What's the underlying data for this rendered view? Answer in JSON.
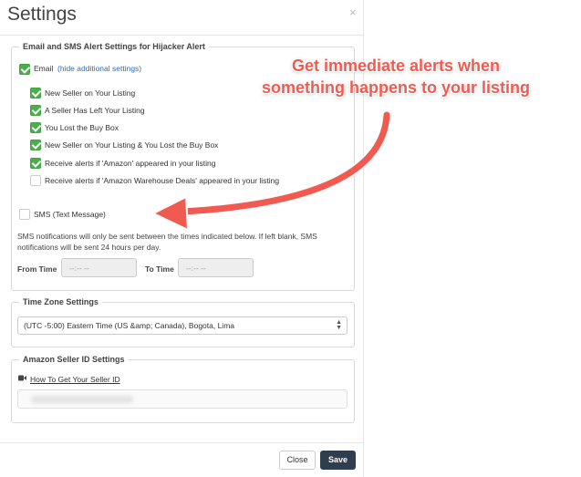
{
  "modal": {
    "title": "Settings",
    "close_symbol": "×"
  },
  "email_section": {
    "legend": "Email and SMS Alert Settings for Hijacker Alert",
    "email": {
      "label": "Email",
      "checked": true,
      "link": "(hide additional settings)"
    },
    "options": [
      {
        "label": "New Seller on Your Listing",
        "checked": true
      },
      {
        "label": "A Seller Has Left Your Listing",
        "checked": true
      },
      {
        "label": "You Lost the Buy Box",
        "checked": true
      },
      {
        "label": "New Seller on Your Listing & You Lost the Buy Box",
        "checked": true
      },
      {
        "label": "Receive alerts if 'Amazon' appeared in your listing",
        "checked": true
      },
      {
        "label": "Receive alerts if 'Amazon Warehouse Deals' appeared in your listing",
        "checked": false
      }
    ],
    "sms": {
      "label": "SMS (Text Message)",
      "checked": false
    },
    "sms_note": "SMS notifications will only be sent between the times indicated below. If left blank, SMS notifications will be sent 24 hours per day.",
    "from_time": {
      "label": "From Time",
      "placeholder": "--:-- --"
    },
    "to_time": {
      "label": "To Time",
      "placeholder": "--:-- --"
    }
  },
  "timezone_section": {
    "legend": "Time Zone Settings",
    "selected": "(UTC -5:00) Eastern Time (US &amp; Canada), Bogota, Lima"
  },
  "seller_section": {
    "legend": "Amazon Seller ID Settings",
    "link": "How To Get Your Seller ID",
    "icon": "video-camera-icon"
  },
  "footer": {
    "close_label": "Close",
    "save_label": "Save"
  },
  "callout": {
    "line1": "Get immediate alerts when",
    "line2": "something happens to your listing",
    "color": "#f15a50"
  },
  "colors": {
    "check_green": "#4cae4c",
    "save_button": "#2f3e4f",
    "link_blue": "#2a6fb5"
  }
}
